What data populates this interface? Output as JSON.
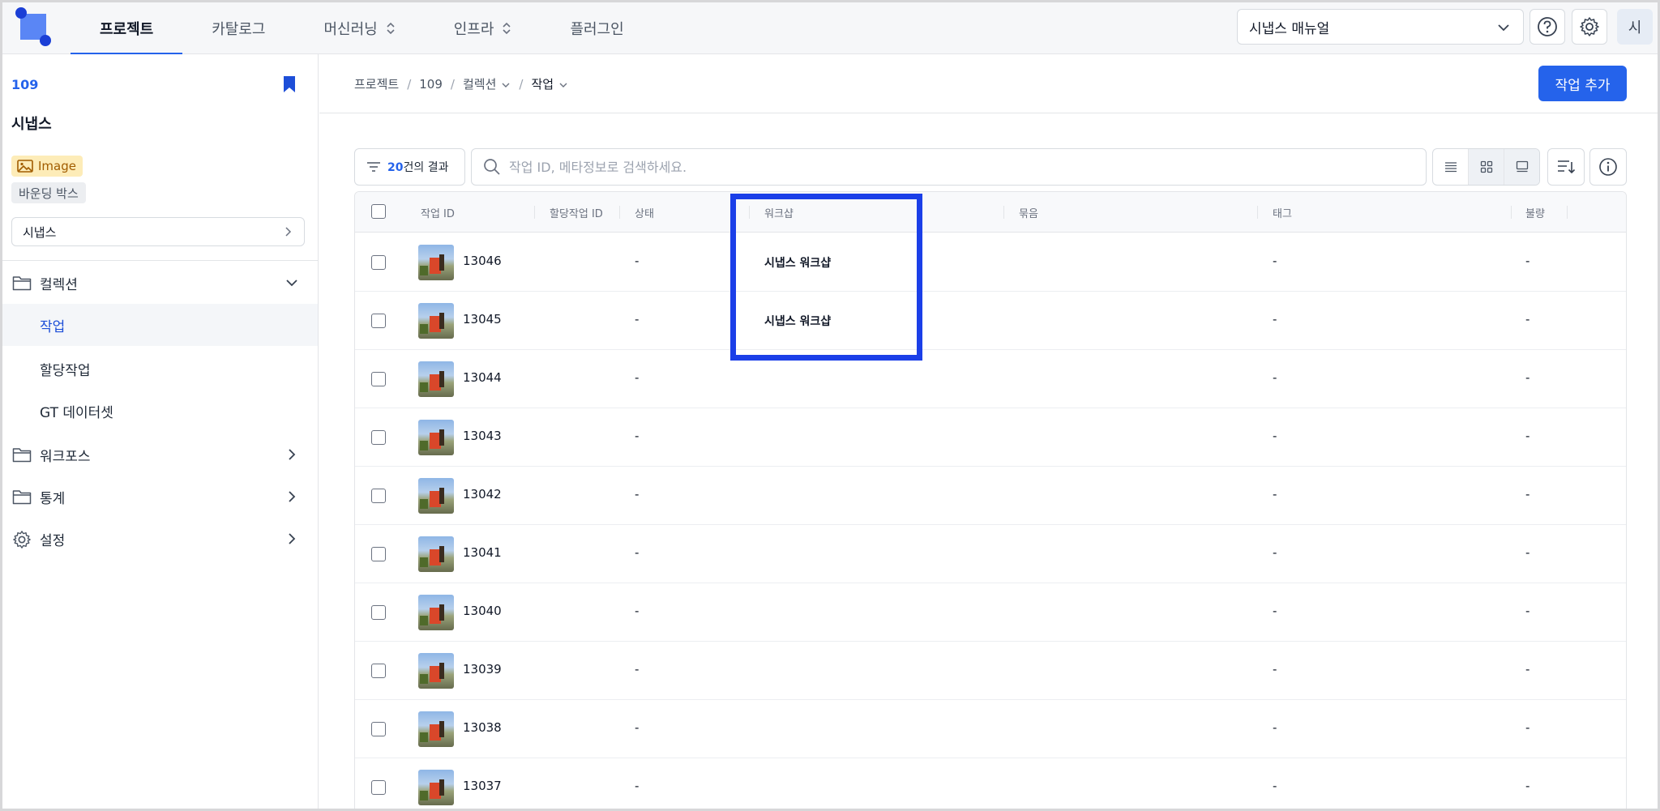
{
  "topnav": {
    "tabs": [
      {
        "label": "프로젝트",
        "active": true
      },
      {
        "label": "카탈로그"
      },
      {
        "label": "머신러닝"
      },
      {
        "label": "인프라"
      },
      {
        "label": "플러그인"
      }
    ],
    "manual_label": "시냅스 매뉴얼",
    "avatar_text": "시"
  },
  "sidebar": {
    "project_id": "109",
    "project_name": "시냅스",
    "badge_image": "Image",
    "badge_bbox": "바운딩 박스",
    "workspace": "시냅스",
    "items": {
      "collection": "컬렉션",
      "task": "작업",
      "assignment": "할당작업",
      "gt_dataset": "GT 데이터셋",
      "workforce": "워크포스",
      "stats": "통계",
      "settings": "설정"
    }
  },
  "main": {
    "breadcrumb": {
      "b1": "프로젝트",
      "b2": "109",
      "b3": "컬렉션",
      "b4": "작업"
    },
    "add_button": "작업 추가",
    "filter": {
      "count": "20",
      "suffix": "건의 결과"
    },
    "search_placeholder": "작업 ID, 메타정보로 검색하세요.",
    "columns": {
      "task_id": "작업 ID",
      "assign_id": "할당작업 ID",
      "status": "상태",
      "workshop": "워크샵",
      "group": "묶음",
      "tag": "태그",
      "defect": "불량"
    },
    "rows": [
      {
        "id": "13046",
        "status": "-",
        "workshop": "시냅스 워크샵",
        "tag": "-",
        "defect": "-"
      },
      {
        "id": "13045",
        "status": "-",
        "workshop": "시냅스 워크샵",
        "tag": "-",
        "defect": "-"
      },
      {
        "id": "13044",
        "status": "-",
        "workshop": "",
        "tag": "-",
        "defect": "-"
      },
      {
        "id": "13043",
        "status": "-",
        "workshop": "",
        "tag": "-",
        "defect": "-"
      },
      {
        "id": "13042",
        "status": "-",
        "workshop": "",
        "tag": "-",
        "defect": "-"
      },
      {
        "id": "13041",
        "status": "-",
        "workshop": "",
        "tag": "-",
        "defect": "-"
      },
      {
        "id": "13040",
        "status": "-",
        "workshop": "",
        "tag": "-",
        "defect": "-"
      },
      {
        "id": "13039",
        "status": "-",
        "workshop": "",
        "tag": "-",
        "defect": "-"
      },
      {
        "id": "13038",
        "status": "-",
        "workshop": "",
        "tag": "-",
        "defect": "-"
      },
      {
        "id": "13037",
        "status": "-",
        "workshop": "",
        "tag": "-",
        "defect": "-"
      }
    ]
  },
  "colors": {
    "accent": "#2563eb",
    "highlight": "#1b3fe8",
    "badge_image_bg": "#fdecb8"
  }
}
